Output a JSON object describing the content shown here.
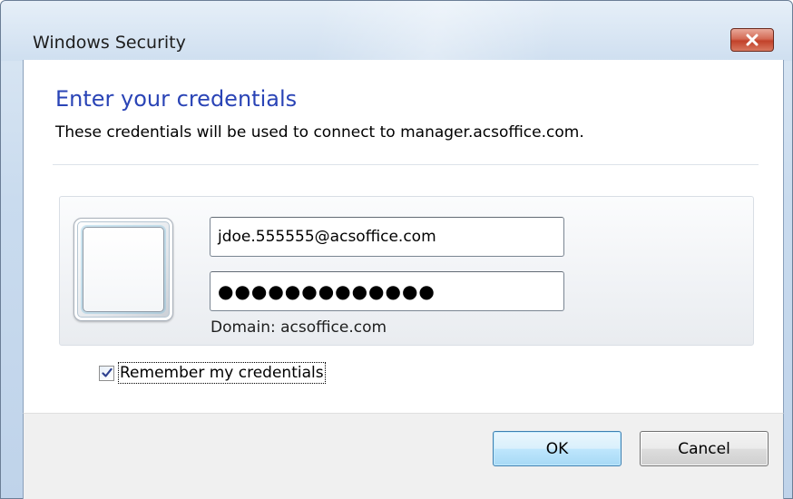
{
  "window": {
    "title": "Windows Security",
    "close_icon": "close-icon"
  },
  "dialog": {
    "heading": "Enter your credentials",
    "description": "These credentials will be used to connect to manager.acsoffice.com."
  },
  "credentials": {
    "user_tile_icon": "user-tile-icon",
    "username_value": "jdoe.555555@acsoffice.com",
    "password_masked": "●●●●●●●●●●●●●",
    "domain_text": "Domain: acsoffice.com"
  },
  "remember": {
    "checked": true,
    "label": "Remember my credentials"
  },
  "buttons": {
    "ok_label": "OK",
    "cancel_label": "Cancel"
  },
  "colors": {
    "heading": "#2a44b6",
    "close_button": "#c2412a",
    "ok_border": "#3c7fb1"
  }
}
